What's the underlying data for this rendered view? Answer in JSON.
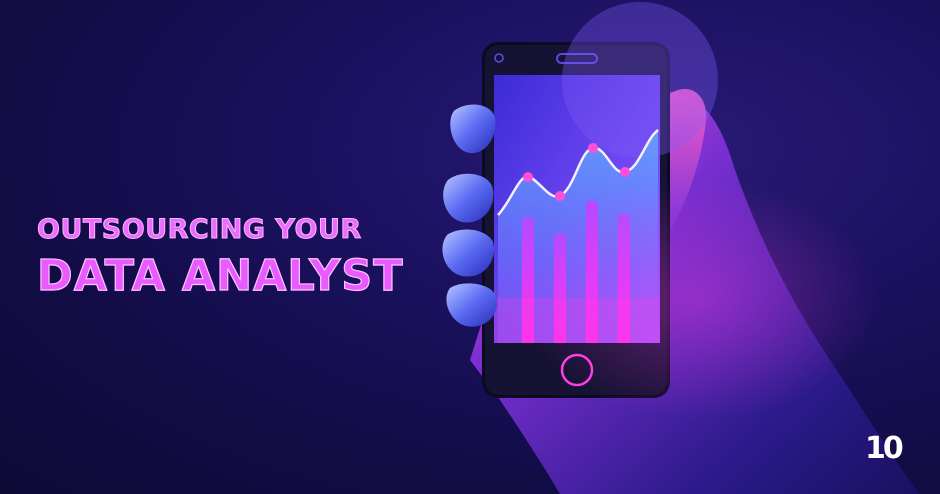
{
  "headline": {
    "line1": "OUTSOURCING YOUR",
    "line2": "DATA ANALYST"
  },
  "logo": {
    "text": "10"
  },
  "colors": {
    "background": "#140d4a",
    "accent_magenta": "#e85cff",
    "screen_blue": "#5b3cf0",
    "bar_pink": "#ff2ff0"
  },
  "illustration": {
    "subject": "hand holding smartphone",
    "screen_chart": {
      "type": "bar-and-line",
      "bars": 4,
      "line_points": 5
    }
  }
}
